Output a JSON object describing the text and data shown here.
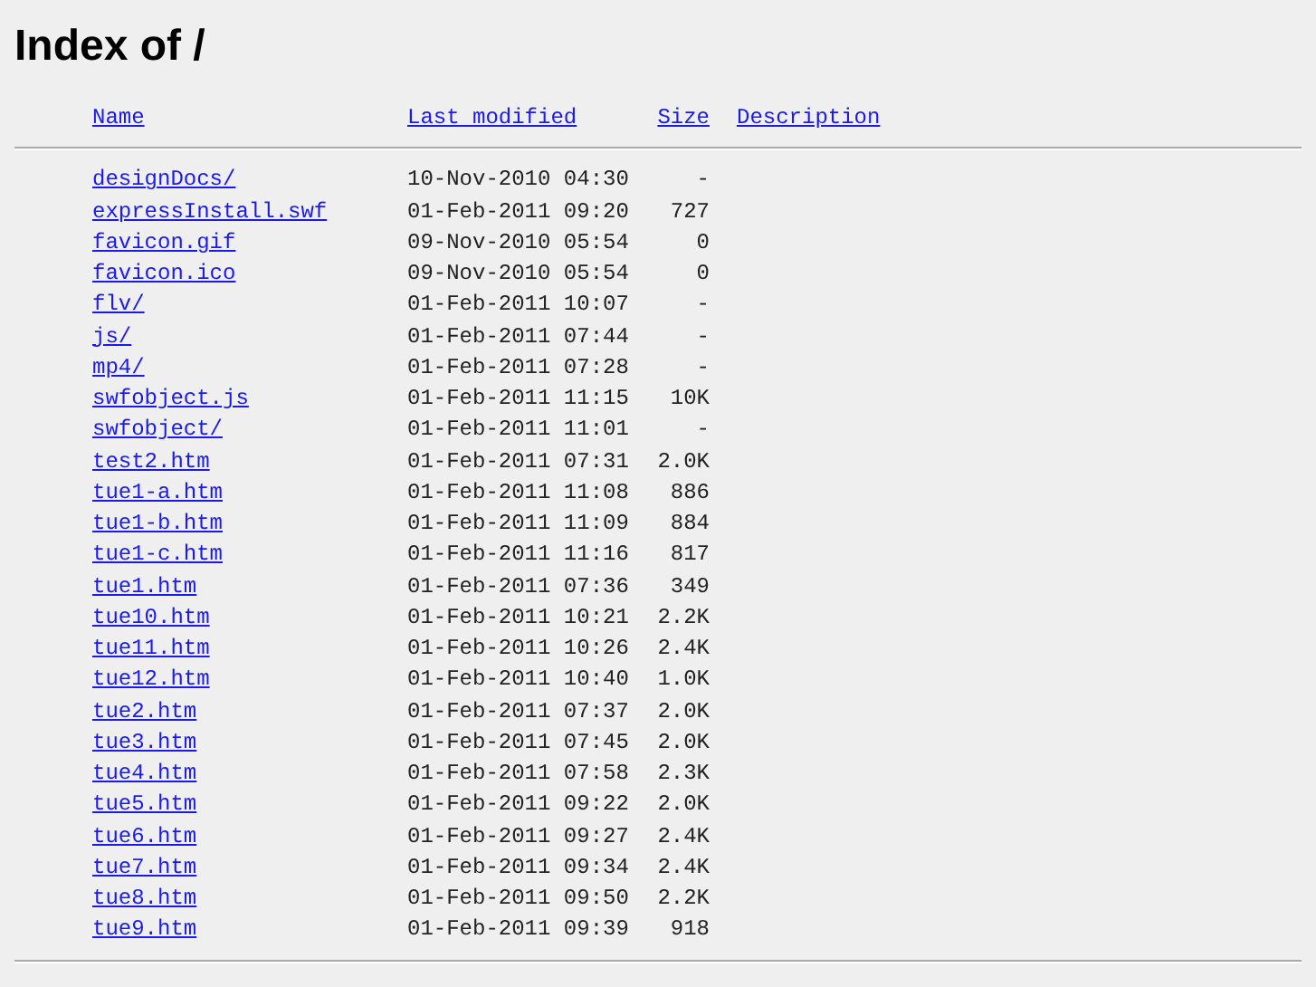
{
  "title": "Index of /",
  "columns": [
    "Name",
    "Last modified",
    "Size",
    "Description"
  ],
  "rows": [
    {
      "name": "designDocs/",
      "modified": "10-Nov-2010 04:30",
      "size": "-"
    },
    {
      "name": "expressInstall.swf",
      "modified": "01-Feb-2011 09:20",
      "size": "727"
    },
    {
      "name": "favicon.gif",
      "modified": "09-Nov-2010 05:54",
      "size": "0"
    },
    {
      "name": "favicon.ico",
      "modified": "09-Nov-2010 05:54",
      "size": "0"
    },
    {
      "name": "flv/",
      "modified": "01-Feb-2011 10:07",
      "size": "-"
    },
    {
      "name": "js/",
      "modified": "01-Feb-2011 07:44",
      "size": "-"
    },
    {
      "name": "mp4/",
      "modified": "01-Feb-2011 07:28",
      "size": "-"
    },
    {
      "name": "swfobject.js",
      "modified": "01-Feb-2011 11:15",
      "size": "10K"
    },
    {
      "name": "swfobject/",
      "modified": "01-Feb-2011 11:01",
      "size": "-"
    },
    {
      "name": "test2.htm",
      "modified": "01-Feb-2011 07:31",
      "size": "2.0K"
    },
    {
      "name": "tue1-a.htm",
      "modified": "01-Feb-2011 11:08",
      "size": "886"
    },
    {
      "name": "tue1-b.htm",
      "modified": "01-Feb-2011 11:09",
      "size": "884"
    },
    {
      "name": "tue1-c.htm",
      "modified": "01-Feb-2011 11:16",
      "size": "817"
    },
    {
      "name": "tue1.htm",
      "modified": "01-Feb-2011 07:36",
      "size": "349"
    },
    {
      "name": "tue10.htm",
      "modified": "01-Feb-2011 10:21",
      "size": "2.2K"
    },
    {
      "name": "tue11.htm",
      "modified": "01-Feb-2011 10:26",
      "size": "2.4K"
    },
    {
      "name": "tue12.htm",
      "modified": "01-Feb-2011 10:40",
      "size": "1.0K"
    },
    {
      "name": "tue2.htm",
      "modified": "01-Feb-2011 07:37",
      "size": "2.0K"
    },
    {
      "name": "tue3.htm",
      "modified": "01-Feb-2011 07:45",
      "size": "2.0K"
    },
    {
      "name": "tue4.htm",
      "modified": "01-Feb-2011 07:58",
      "size": "2.3K"
    },
    {
      "name": "tue5.htm",
      "modified": "01-Feb-2011 09:22",
      "size": "2.0K"
    },
    {
      "name": "tue6.htm",
      "modified": "01-Feb-2011 09:27",
      "size": "2.4K"
    },
    {
      "name": "tue7.htm",
      "modified": "01-Feb-2011 09:34",
      "size": "2.4K"
    },
    {
      "name": "tue8.htm",
      "modified": "01-Feb-2011 09:50",
      "size": "2.2K"
    },
    {
      "name": "tue9.htm",
      "modified": "01-Feb-2011 09:39",
      "size": "918"
    }
  ]
}
